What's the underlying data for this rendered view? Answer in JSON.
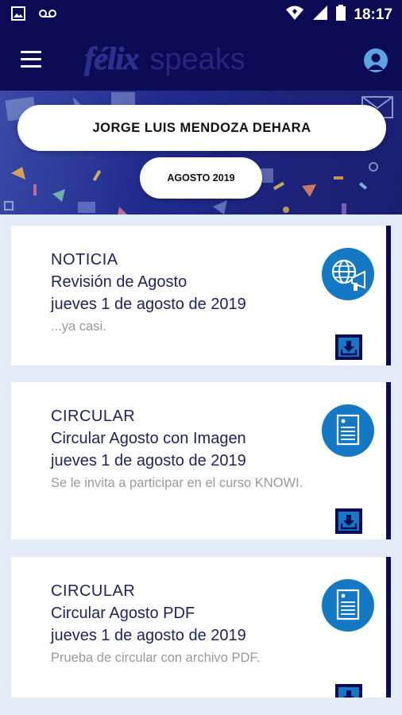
{
  "status_bar": {
    "time": "18:17",
    "icons": [
      "image-icon",
      "voicemail-icon",
      "wifi-icon",
      "cell-signal-icon",
      "battery-icon"
    ]
  },
  "app_bar": {
    "menu_icon": "hamburger-menu-icon",
    "logo_part1": "félix",
    "logo_part2": "speaks",
    "profile_icon": "user-avatar-icon"
  },
  "header": {
    "student_name": "JORGE LUIS MENDOZA DEHARA",
    "month": "AGOSTO 2019"
  },
  "colors": {
    "navy": "#0a0b52",
    "accent_blue": "#1478c4",
    "text_dark": "#20245e",
    "text_muted": "#9a9a9a"
  },
  "items": [
    {
      "type": "NOTICIA",
      "title": "Revisión de Agosto",
      "date": "jueves 1 de agosto de 2019",
      "desc": "...ya casi.",
      "icon": "globe-megaphone-icon"
    },
    {
      "type": "CIRCULAR",
      "title": "Circular Agosto con Imagen",
      "date": "jueves 1 de agosto de 2019",
      "desc": "Se le invita a participar en el curso KNOWI.",
      "icon": "document-icon"
    },
    {
      "type": "CIRCULAR",
      "title": "Circular Agosto PDF",
      "date": "jueves 1 de agosto de 2019",
      "desc": "Prueba de circular con archivo PDF.",
      "icon": "document-icon"
    }
  ]
}
